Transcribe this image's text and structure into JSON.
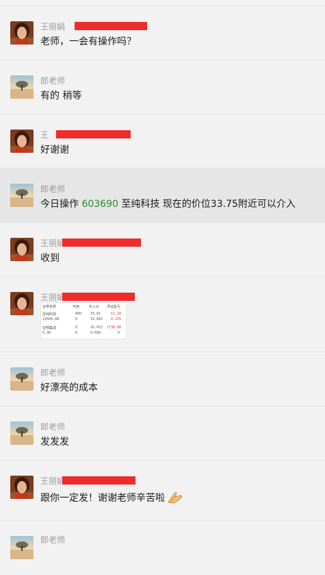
{
  "messages": [
    {
      "sender": "王丽娟",
      "avatar": "woman-avatar",
      "text": "老师，一会有操作吗？"
    },
    {
      "sender": "郎老师",
      "avatar": "sunset-avatar",
      "text": "有的  稍等"
    },
    {
      "sender": "王",
      "avatar": "woman-avatar",
      "text": "好谢谢"
    },
    {
      "sender": "郎老师",
      "avatar": "sunset-avatar",
      "text_prefix": "今日操作 ",
      "stock_code": "603690",
      "text_suffix": " 至纯科技 现在的价位33.75附近可以介入"
    },
    {
      "sender": "王丽娟",
      "avatar": "woman-avatar",
      "text": "收到"
    },
    {
      "sender": "王丽娟",
      "avatar": "woman-avatar",
      "image": {
        "headers": [
          "证券名称",
          "可用",
          "买入价",
          "浮动盈亏"
        ],
        "rows": [
          [
            "至纯科技",
            "400",
            "33.81",
            "11.28"
          ],
          [
            "13504.08",
            "0",
            "33.893",
            "0.23%"
          ],
          [
            "亚翔集成",
            "0",
            "16.472",
            "1738.08"
          ],
          [
            "0.30",
            "0",
            "0.030",
            "0"
          ]
        ]
      }
    },
    {
      "sender": "郎老师",
      "avatar": "sunset-avatar",
      "text": "好漂亮的成本"
    },
    {
      "sender": "郎老师",
      "avatar": "sunset-avatar",
      "text": "发发发"
    },
    {
      "sender": "王丽娟",
      "avatar": "woman-avatar",
      "text": "跟你一定发！谢谢老师辛苦啦",
      "emoji": "praying-hands-icon"
    },
    {
      "sender": "郎老师",
      "avatar": "sunset-avatar"
    }
  ],
  "colors": {
    "background": "#f2f2f2",
    "highlight": "#e6e6e6",
    "redaction": "#ef2b2b",
    "stock_code": "#2a8a2a",
    "sender_name": "#9b9b9b"
  }
}
